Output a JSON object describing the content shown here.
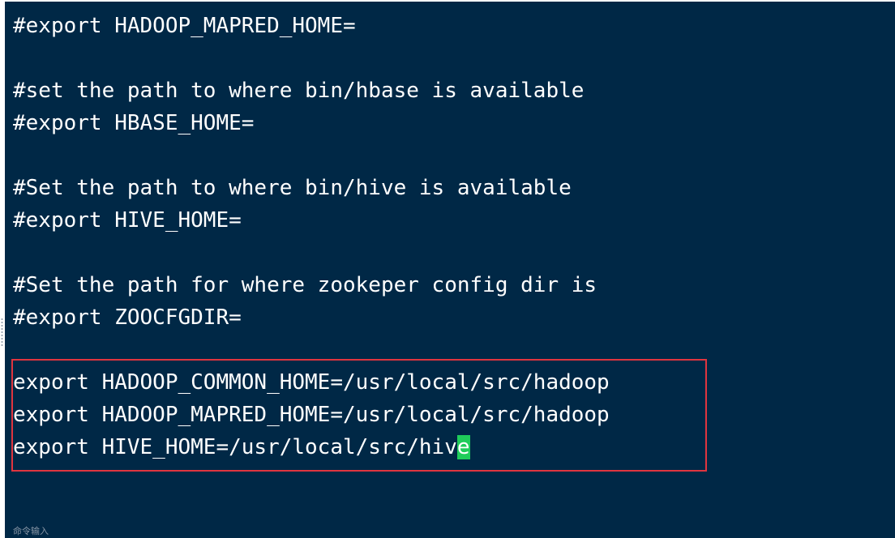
{
  "terminal": {
    "lines": [
      "#export HADOOP_MAPRED_HOME=",
      "",
      "#set the path to where bin/hbase is available",
      "#export HBASE_HOME=",
      "",
      "#Set the path to where bin/hive is available",
      "#export HIVE_HOME=",
      "",
      "#Set the path for where zookeper config dir is",
      "#export ZOOCFGDIR=",
      "",
      "export HADOOP_COMMON_HOME=/usr/local/src/hadoop",
      "export HADOOP_MAPRED_HOME=/usr/local/src/hadoop",
      "export HIVE_HOME=/usr/local/src/hiv"
    ],
    "cursor_char": "e",
    "status_text": "命令输入"
  },
  "colors": {
    "background": "#002846",
    "text": "#ffffff",
    "cursor": "#1fcc5a",
    "highlight_border": "#e0353f"
  }
}
